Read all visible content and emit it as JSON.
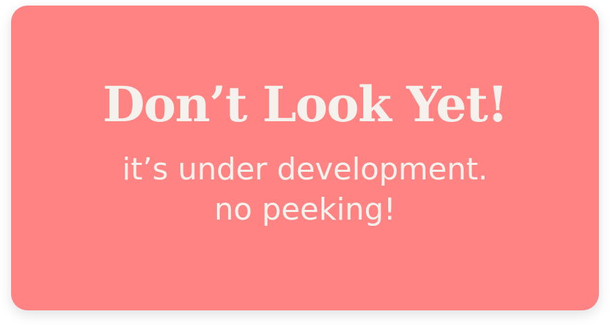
{
  "banner": {
    "title": "Don’t Look Yet!",
    "subtitle_line1": "it’s under development.",
    "subtitle_line2": "no peeking!"
  },
  "colors": {
    "background": "#ff8383",
    "text": "#f5f2ee",
    "page": "#ffffff"
  }
}
